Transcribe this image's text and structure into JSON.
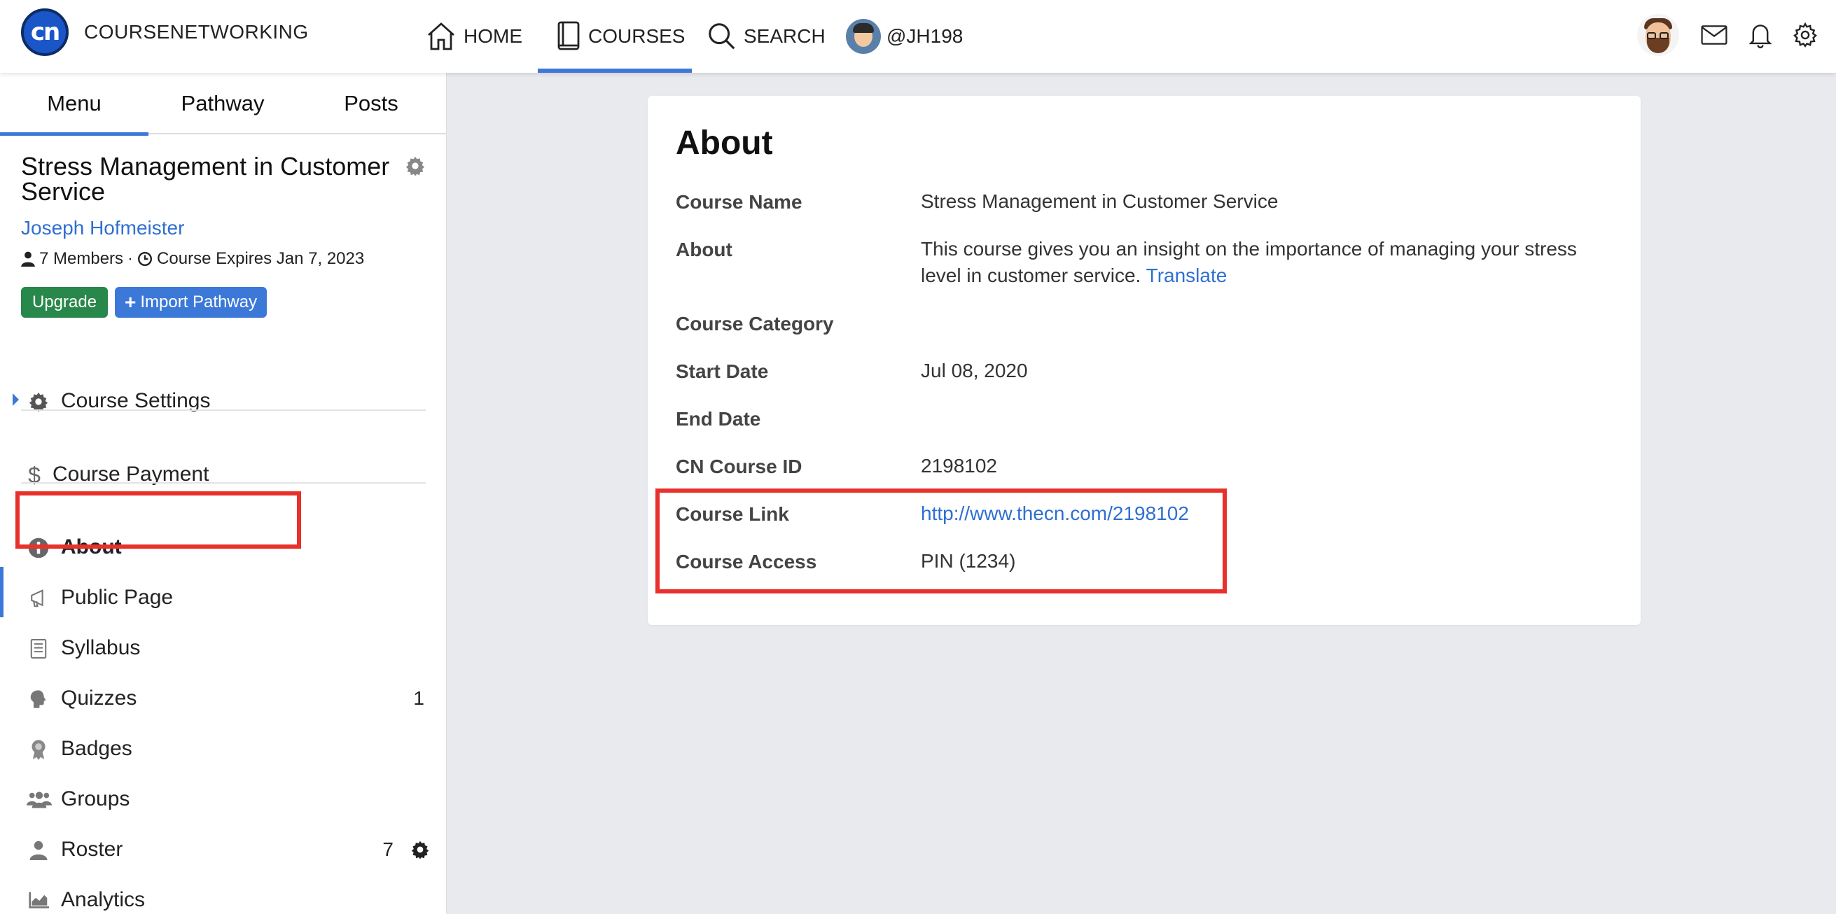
{
  "topbar": {
    "brand": "COURSENETWORKING",
    "logo_text": "cn",
    "nav": {
      "home": "HOME",
      "courses": "COURSES",
      "search": "SEARCH",
      "user": "@JH198"
    },
    "icons": [
      "mail-icon",
      "bell-icon",
      "gear-icon"
    ]
  },
  "sidebar": {
    "tabs": [
      "Menu",
      "Pathway",
      "Posts"
    ],
    "course_title": "Stress Management in Customer Service",
    "instructor": "Joseph Hofmeister",
    "members": "7 Members",
    "separator": "·",
    "expires": "Course Expires Jan 7, 2023",
    "upgrade_label": "Upgrade",
    "import_label": "Import Pathway",
    "items": [
      {
        "label": "Course Settings",
        "icon": "gear-icon"
      },
      {
        "label": "Course Payment",
        "icon": "dollar-icon"
      },
      {
        "label": "About",
        "icon": "info-icon"
      },
      {
        "label": "Public Page",
        "icon": "megaphone-icon"
      },
      {
        "label": "Syllabus",
        "icon": "document-icon"
      },
      {
        "label": "Quizzes",
        "icon": "brain-icon",
        "count": "1"
      },
      {
        "label": "Badges",
        "icon": "badge-icon"
      },
      {
        "label": "Groups",
        "icon": "groups-icon"
      },
      {
        "label": "Roster",
        "icon": "person-icon",
        "count": "7"
      },
      {
        "label": "Analytics",
        "icon": "chart-icon"
      }
    ]
  },
  "about": {
    "title": "About",
    "fields": {
      "course_name_label": "Course Name",
      "course_name_value": "Stress Management in Customer Service",
      "about_label": "About",
      "about_value": "This course gives you an insight on the importance of managing your stress level in customer service.",
      "translate": "Translate",
      "category_label": "Course Category",
      "category_value": "",
      "start_label": "Start Date",
      "start_value": "Jul 08, 2020",
      "end_label": "End Date",
      "end_value": "",
      "id_label": "CN Course ID",
      "id_value": "2198102",
      "link_label": "Course Link",
      "link_value": "http://www.thecn.com/2198102",
      "access_label": "Course Access",
      "access_value": "PIN (1234)"
    }
  },
  "colors": {
    "accent": "#3b78d8",
    "upgrade": "#28874a",
    "highlight": "#e8312b",
    "link": "#2f6fd1"
  }
}
